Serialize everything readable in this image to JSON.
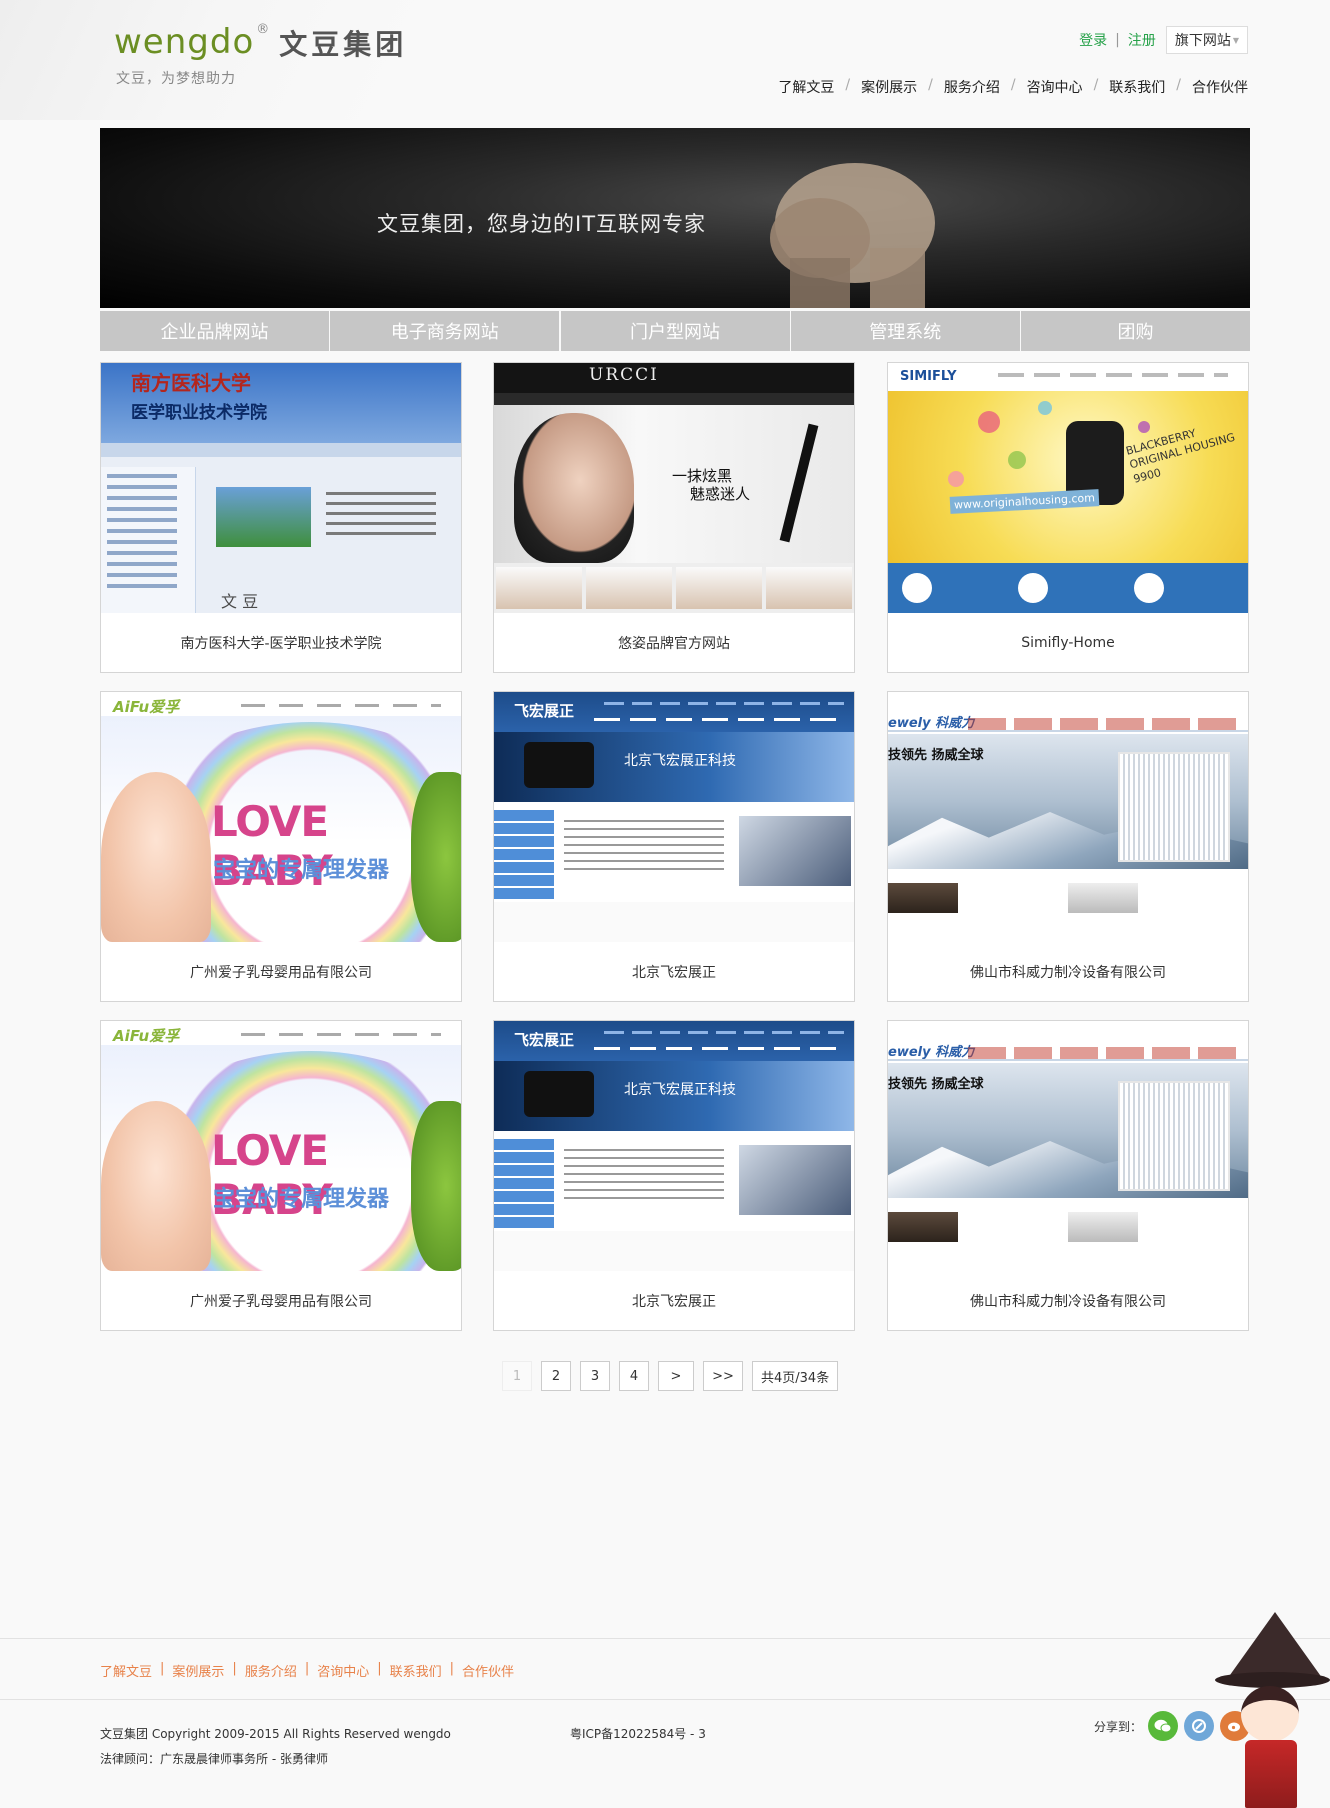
{
  "header": {
    "logo_mark": "wengdo",
    "logo_reg": "®",
    "logo_cn": "文豆集团",
    "tagline": "文豆，为梦想助力",
    "login": "登录",
    "sep": "|",
    "register": "注册",
    "sites_dropdown": "旗下网站",
    "nav": [
      "了解文豆",
      "案例展示",
      "服务介绍",
      "咨询中心",
      "联系我们",
      "合作伙伴"
    ],
    "nav_sep": "/"
  },
  "banner": {
    "text": "文豆集团，您身边的IT互联网专家"
  },
  "category_tabs": [
    "企业品牌网站",
    "电子商务网站",
    "门户型网站",
    "管理系统",
    "团购"
  ],
  "thumbs": {
    "uni": {
      "line1": "南方医科大学",
      "line2": "医学职业技术学院",
      "watermark": "文 豆"
    },
    "cos": {
      "brand": "URCCI",
      "s1": "一抹炫黑",
      "s2": "魅惑迷人"
    },
    "sim": {
      "brand": "SIMIFLY",
      "tag": "BLACKBERRY ORIGINAL HOUSING 9900",
      "url": "www.originalhousing.com"
    },
    "baby": {
      "brand": "AiFu爱孚",
      "line1": "LOVE BABY",
      "line2": "宝宝的专属理发器"
    },
    "proj": {
      "brand": "飞宏展正",
      "hero": "北京飞宏展正科技"
    },
    "cool": {
      "brand": "ewely 科威力",
      "hero": "技领先 扬威全球"
    }
  },
  "cases": [
    {
      "title": "南方医科大学-医学职业技术学院",
      "thumb": "uni"
    },
    {
      "title": "悠姿品牌官方网站",
      "thumb": "cos"
    },
    {
      "title": "Simifly-Home",
      "thumb": "sim"
    },
    {
      "title": "广州爱子乳母婴用品有限公司",
      "thumb": "baby"
    },
    {
      "title": "北京飞宏展正",
      "thumb": "proj"
    },
    {
      "title": "佛山市科威力制冷设备有限公司",
      "thumb": "cool"
    },
    {
      "title": "广州爱子乳母婴用品有限公司",
      "thumb": "baby"
    },
    {
      "title": "北京飞宏展正",
      "thumb": "proj"
    },
    {
      "title": "佛山市科威力制冷设备有限公司",
      "thumb": "cool"
    }
  ],
  "pagination": {
    "current": "1",
    "pages": [
      "2",
      "3",
      "4"
    ],
    "next": ">",
    "last": ">>",
    "summary": "共4页/34条"
  },
  "footer": {
    "nav": [
      "了解文豆",
      "案例展示",
      "服务介绍",
      "咨询中心",
      "联系我们",
      "合作伙伴"
    ],
    "nav_sep": "|",
    "copyright": "文豆集团 Copyright 2009-2015 All Rights Reserved wengdo",
    "icp": "粤ICP备12022584号 - 3",
    "legal": "法律顾问：广东晟晨律师事务所 - 张勇律师",
    "share_label": "分享到："
  },
  "colors": {
    "accent_green": "#27a24a",
    "footer_link": "#e8824a",
    "tab_bg": "#c6c6c6"
  }
}
